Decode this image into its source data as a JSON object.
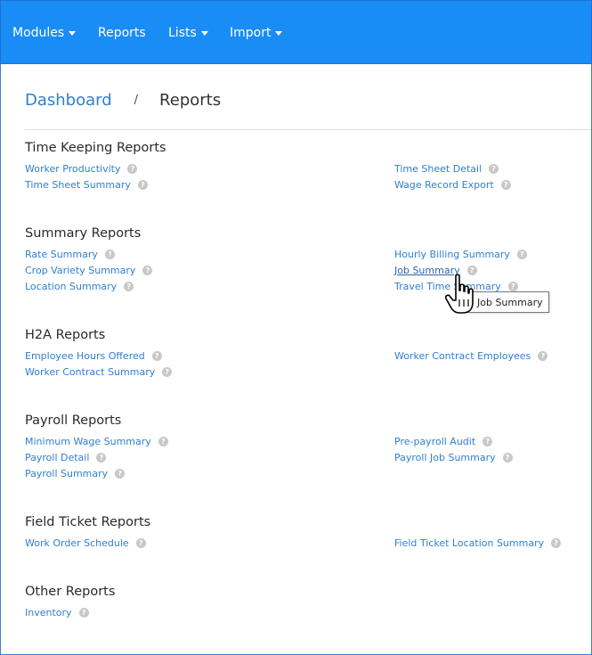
{
  "nav": {
    "modules": "Modules",
    "reports": "Reports",
    "lists": "Lists",
    "import": "Import"
  },
  "breadcrumb": {
    "dashboard": "Dashboard",
    "separator": "/",
    "current": "Reports"
  },
  "sections": {
    "time_keeping": {
      "title": "Time Keeping Reports",
      "left": [
        "Worker Productivity",
        "Time Sheet Summary"
      ],
      "right": [
        "Time Sheet Detail",
        "Wage Record Export"
      ]
    },
    "summary": {
      "title": "Summary Reports",
      "left": [
        "Rate Summary",
        "Crop Variety Summary",
        "Location Summary"
      ],
      "right": [
        "Hourly Billing Summary",
        "Job Summary",
        "Travel Time Summary"
      ]
    },
    "h2a": {
      "title": "H2A Reports",
      "left": [
        "Employee Hours Offered",
        "Worker Contract Summary"
      ],
      "right": [
        "Worker Contract Employees"
      ]
    },
    "payroll": {
      "title": "Payroll Reports",
      "left": [
        "Minimum Wage Summary",
        "Payroll Detail",
        "Payroll Summary"
      ],
      "right": [
        "Pre-payroll Audit",
        "Payroll Job Summary"
      ]
    },
    "field_ticket": {
      "title": "Field Ticket Reports",
      "left": [
        "Work Order Schedule"
      ],
      "right": [
        "Field Ticket Location Summary"
      ]
    },
    "other": {
      "title": "Other Reports",
      "left": [
        "Inventory"
      ],
      "right": []
    }
  },
  "help_glyph": "?",
  "tooltip": "Job Summary",
  "icons": {
    "help": "question-circle-icon",
    "caret": "caret-down-icon",
    "cursor": "hand-pointer-icon"
  },
  "colors": {
    "navbar": "#1a8cf6",
    "link": "#2f7fd0",
    "help_badge": "#c8c8c8"
  }
}
